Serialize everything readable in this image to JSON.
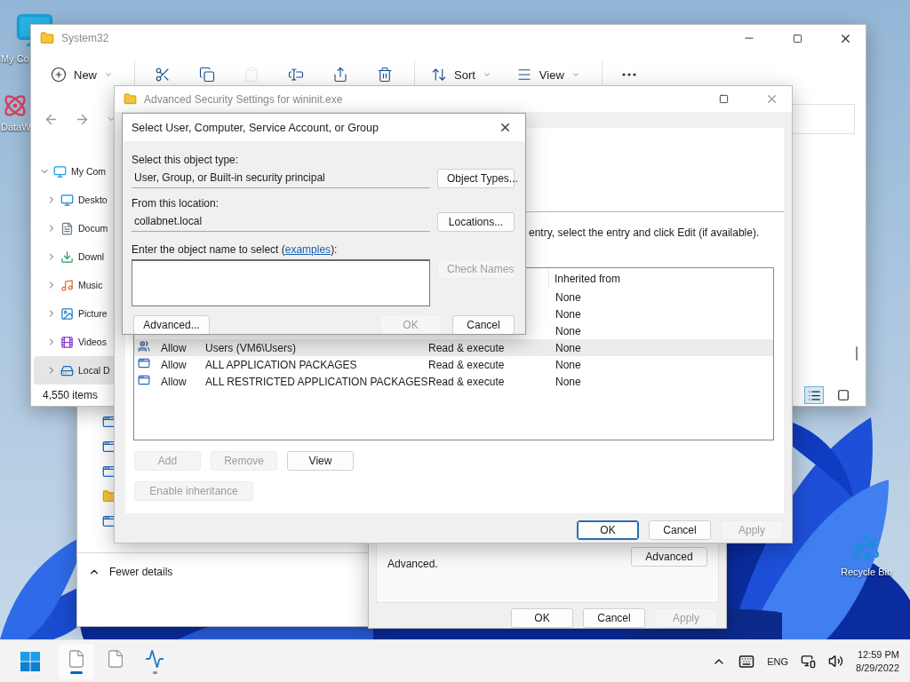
{
  "desktop_icons": [
    {
      "kind": "computer",
      "label": "My Co"
    },
    {
      "kind": "atom",
      "label": "DataW"
    },
    {
      "kind": "recycle",
      "label": "Recycle Bin"
    }
  ],
  "task_window": {
    "items": [
      {
        "kind": "app"
      },
      {
        "kind": "app"
      },
      {
        "kind": "app"
      },
      {
        "kind": "folder"
      },
      {
        "kind": "app"
      }
    ],
    "footer": "Fewer details"
  },
  "properties_window": {
    "note": "Advanced.",
    "advanced_button": "Advanced",
    "buttons": [
      {
        "label": "OK",
        "disabled": false
      },
      {
        "label": "Cancel",
        "disabled": false
      },
      {
        "label": "Apply",
        "disabled": true
      }
    ]
  },
  "explorer": {
    "title": "System32",
    "toolbar": [
      {
        "kind": "new",
        "label": "New",
        "disabled": false
      },
      {
        "kind": "cut",
        "disabled": false
      },
      {
        "kind": "copy",
        "disabled": false
      },
      {
        "kind": "paste",
        "disabled": true
      },
      {
        "kind": "rename",
        "disabled": false
      },
      {
        "kind": "share",
        "disabled": false
      },
      {
        "kind": "delete",
        "disabled": false
      },
      {
        "kind": "sort",
        "label": "Sort",
        "disabled": false
      },
      {
        "kind": "view",
        "label": "View",
        "disabled": false
      },
      {
        "kind": "more",
        "disabled": false
      }
    ],
    "tree": [
      {
        "label": "My Com",
        "kind": "computer",
        "expanded": true,
        "selected": false,
        "children": [
          {
            "label": "Deskto",
            "kind": "desktop",
            "expanded": false,
            "selected": false
          },
          {
            "label": "Docum",
            "kind": "documents",
            "expanded": false,
            "selected": false
          },
          {
            "label": "Downl",
            "kind": "downloads",
            "expanded": false,
            "selected": false
          },
          {
            "label": "Music",
            "kind": "music",
            "expanded": false,
            "selected": false
          },
          {
            "label": "Picture",
            "kind": "pictures",
            "expanded": false,
            "selected": false
          },
          {
            "label": "Videos",
            "kind": "videos",
            "expanded": false,
            "selected": false
          },
          {
            "label": "Local D",
            "kind": "drive",
            "expanded": false,
            "selected": true
          }
        ]
      }
    ],
    "status": "4,550 items",
    "view_modes": [
      {
        "kind": "details",
        "selected": true
      },
      {
        "kind": "tiles",
        "selected": false
      }
    ]
  },
  "security": {
    "title": "Advanced Security Settings for wininit.exe",
    "instruction": "entry, select the entry and click Edit (if available).",
    "table": {
      "columns": [
        "Inherited from"
      ],
      "rows": [
        {
          "inherited": "None",
          "selected": false
        },
        {
          "inherited": "None",
          "selected": false
        },
        {
          "inherited": "None",
          "selected": false
        },
        {
          "kind": "group",
          "type": "Allow",
          "principal": "Users (VM6\\Users)",
          "access": "Read & execute",
          "inherited": "None",
          "selected": true
        },
        {
          "kind": "package",
          "type": "Allow",
          "principal": "ALL APPLICATION PACKAGES",
          "access": "Read & execute",
          "inherited": "None",
          "selected": false
        },
        {
          "kind": "package",
          "type": "Allow",
          "principal": "ALL RESTRICTED APPLICATION PACKAGES",
          "access": "Read & execute",
          "inherited": "None",
          "selected": false
        }
      ]
    },
    "buttons": [
      {
        "label": "Add",
        "disabled": true
      },
      {
        "label": "Remove",
        "disabled": true
      },
      {
        "label": "View",
        "disabled": false
      }
    ],
    "inheritance_button": {
      "label": "Enable inheritance",
      "disabled": true
    },
    "footer_buttons": [
      {
        "label": "OK",
        "disabled": false,
        "default": true
      },
      {
        "label": "Cancel",
        "disabled": false,
        "default": false
      },
      {
        "label": "Apply",
        "disabled": true,
        "default": false
      }
    ]
  },
  "select_dialog": {
    "title": "Select User, Computer, Service Account, or Group",
    "object_type_label": "Select this object type:",
    "object_type": "User, Group, or Built-in security principal",
    "object_types_button": "Object Types...",
    "location_label": "From this location:",
    "location": "collabnet.local",
    "locations_button": "Locations...",
    "name_label": {
      "prefix": "Enter the object name to select (",
      "link": "examples",
      "suffix": "):"
    },
    "check_names": {
      "label": "Check Names",
      "disabled": true
    },
    "buttons": [
      {
        "label": "Advanced...",
        "disabled": false
      },
      {
        "label": "OK",
        "disabled": true
      },
      {
        "label": "Cancel",
        "disabled": false
      }
    ]
  },
  "taskbar": {
    "apps": [
      {
        "kind": "document",
        "active": true,
        "running": true
      },
      {
        "kind": "document",
        "active": false,
        "running": false
      },
      {
        "kind": "monitor",
        "active": false,
        "running": true
      }
    ],
    "language": "ENG",
    "time": "12:59 PM",
    "date": "8/29/2022"
  }
}
